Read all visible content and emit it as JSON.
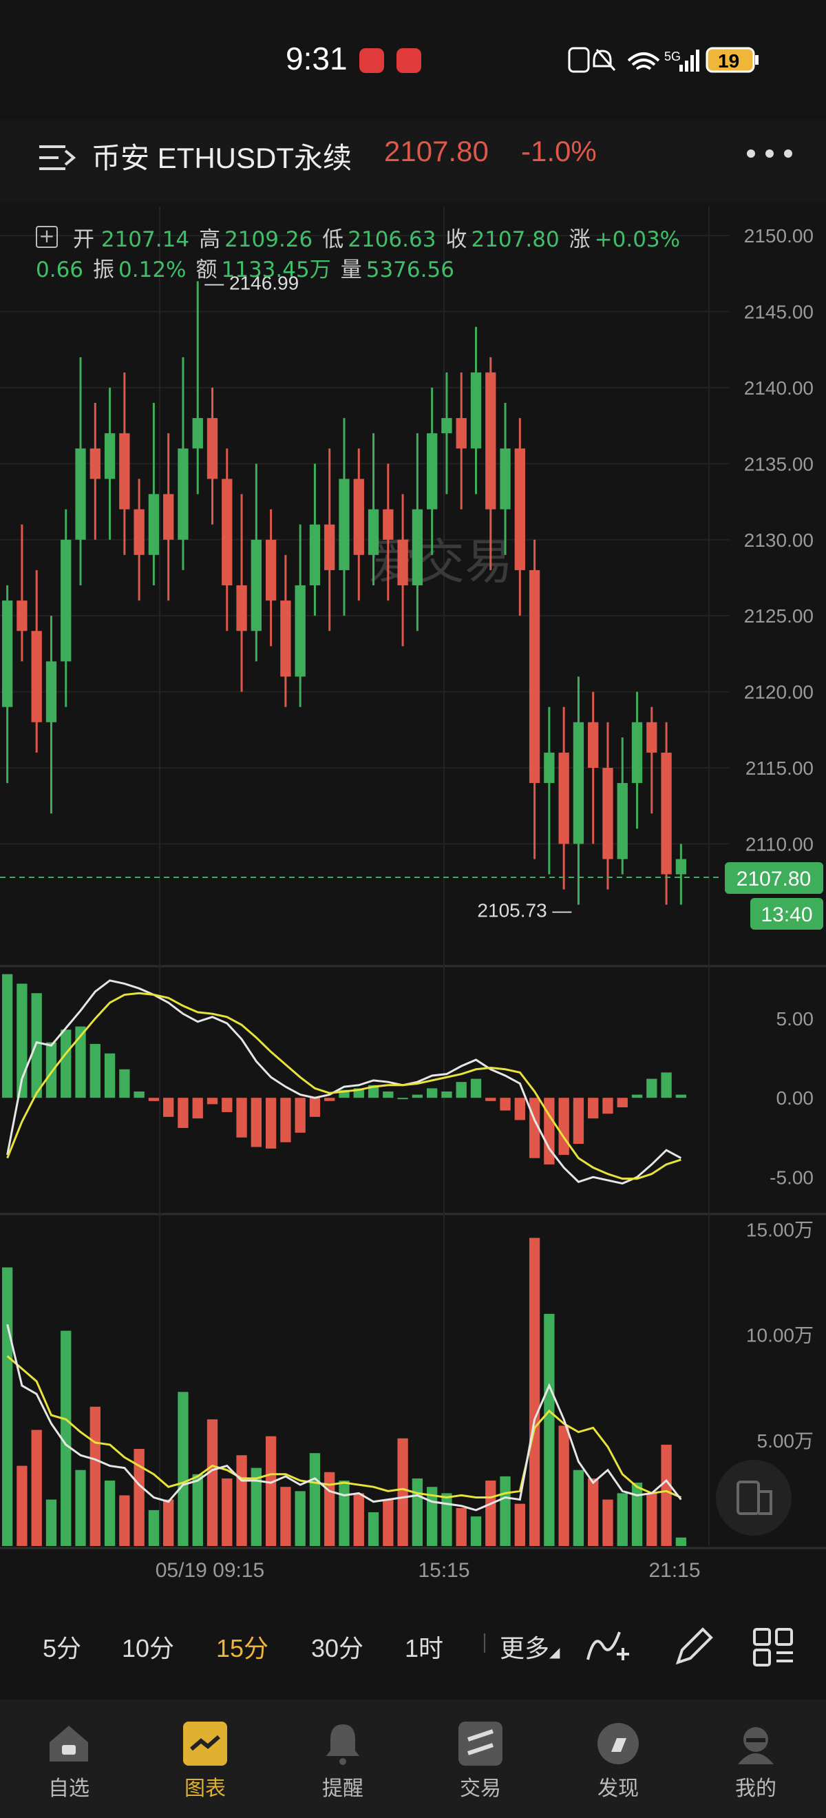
{
  "status_bar": {
    "time": "9:31",
    "battery": "19",
    "network": "5G"
  },
  "header": {
    "title": "币安 ETHUSDT永续",
    "price": "2107.80",
    "change": "-1.0%"
  },
  "ohlc": {
    "open_label": "开",
    "open": "2107.14",
    "high_label": "高",
    "high": "2109.26",
    "low_label": "低",
    "low": "2106.63",
    "close_label": "收",
    "close": "2107.80",
    "chg_label": "涨",
    "chg": "+0.03%",
    "chg_abs": "0.66",
    "amp_label": "振",
    "amp": "0.12%",
    "amount_label": "额",
    "amount": "1133.45万",
    "vol_label": "量",
    "vol": "5376.56"
  },
  "watermark": "爱交易",
  "chart_data": [
    {
      "type": "candlestick",
      "title": "",
      "price_axis_ticks": [
        "2150.00",
        "2145.00",
        "2140.00",
        "2135.00",
        "2130.00",
        "2125.00",
        "2120.00",
        "2115.00",
        "2110.00"
      ],
      "ylim": [
        2103,
        2151
      ],
      "high_marker": "2146.99",
      "low_marker": "2105.73",
      "last_price": "2107.80",
      "countdown": "13:40",
      "time_labels": [
        "05/19 09:15",
        "15:15",
        "21:15"
      ],
      "candles": [
        [
          2119,
          2126,
          2114,
          2127
        ],
        [
          2126,
          2124,
          2122,
          2131
        ],
        [
          2124,
          2118,
          2116,
          2128
        ],
        [
          2118,
          2122,
          2112,
          2125
        ],
        [
          2122,
          2130,
          2119,
          2132
        ],
        [
          2130,
          2136,
          2127,
          2142
        ],
        [
          2136,
          2134,
          2130,
          2139
        ],
        [
          2134,
          2137,
          2130,
          2140
        ],
        [
          2137,
          2132,
          2129,
          2141
        ],
        [
          2132,
          2129,
          2126,
          2134
        ],
        [
          2129,
          2133,
          2127,
          2139
        ],
        [
          2133,
          2130,
          2126,
          2137
        ],
        [
          2130,
          2136,
          2128,
          2142
        ],
        [
          2136,
          2138,
          2133,
          2147
        ],
        [
          2138,
          2134,
          2131,
          2140
        ],
        [
          2134,
          2127,
          2124,
          2136
        ],
        [
          2127,
          2124,
          2120,
          2133
        ],
        [
          2124,
          2130,
          2122,
          2135
        ],
        [
          2130,
          2126,
          2123,
          2132
        ],
        [
          2126,
          2121,
          2119,
          2129
        ],
        [
          2121,
          2127,
          2119,
          2131
        ],
        [
          2127,
          2131,
          2125,
          2135
        ],
        [
          2131,
          2128,
          2124,
          2136
        ],
        [
          2128,
          2134,
          2125,
          2138
        ],
        [
          2134,
          2129,
          2126,
          2136
        ],
        [
          2129,
          2132,
          2127,
          2137
        ],
        [
          2132,
          2130,
          2126,
          2135
        ],
        [
          2130,
          2127,
          2123,
          2133
        ],
        [
          2127,
          2132,
          2124,
          2137
        ],
        [
          2132,
          2137,
          2129,
          2140
        ],
        [
          2137,
          2138,
          2133,
          2141
        ],
        [
          2138,
          2136,
          2132,
          2141
        ],
        [
          2136,
          2141,
          2133,
          2144
        ],
        [
          2141,
          2132,
          2128,
          2142
        ],
        [
          2132,
          2136,
          2129,
          2139
        ],
        [
          2136,
          2128,
          2125,
          2138
        ],
        [
          2128,
          2114,
          2109,
          2130
        ],
        [
          2114,
          2116,
          2108,
          2119
        ],
        [
          2116,
          2110,
          2107,
          2119
        ],
        [
          2110,
          2118,
          2106,
          2121
        ],
        [
          2118,
          2115,
          2110,
          2120
        ],
        [
          2115,
          2109,
          2107,
          2118
        ],
        [
          2109,
          2114,
          2108,
          2117
        ],
        [
          2114,
          2118,
          2111,
          2120
        ],
        [
          2118,
          2116,
          2112,
          2119
        ],
        [
          2116,
          2108,
          2106,
          2118
        ],
        [
          2108,
          2109,
          2106,
          2110
        ]
      ]
    },
    {
      "type": "line",
      "name": "MACD",
      "y_ticks": [
        "5.00",
        "0.00",
        "-5.00"
      ],
      "ylim": [
        -7.2,
        8
      ],
      "series": [
        {
          "name": "DIF",
          "color": "#e6e6e6",
          "values": [
            -3.6,
            1.2,
            3.5,
            3.3,
            4.4,
            5.5,
            6.7,
            7.4,
            7.2,
            6.9,
            6.5,
            6.0,
            5.3,
            4.8,
            5.1,
            4.7,
            3.7,
            2.3,
            1.3,
            0.7,
            0.2,
            0.0,
            0.2,
            0.7,
            0.8,
            1.1,
            1.0,
            0.8,
            1.0,
            1.4,
            1.5,
            2.0,
            2.4,
            1.8,
            1.4,
            0.9,
            -1.4,
            -3.2,
            -4.4,
            -5.3,
            -5.0,
            -5.2,
            -5.4,
            -5.0,
            -4.2,
            -3.3,
            -3.8
          ]
        },
        {
          "name": "DEA",
          "color": "#e8e33a",
          "values": [
            -3.8,
            -1.5,
            0.3,
            1.6,
            2.8,
            3.9,
            5.0,
            6.0,
            6.5,
            6.6,
            6.5,
            6.3,
            5.8,
            5.4,
            5.3,
            5.1,
            4.6,
            3.8,
            2.9,
            2.1,
            1.3,
            0.6,
            0.3,
            0.4,
            0.5,
            0.7,
            0.8,
            0.8,
            0.9,
            1.1,
            1.3,
            1.5,
            1.8,
            1.9,
            1.8,
            1.6,
            0.4,
            -1.1,
            -2.5,
            -3.8,
            -4.4,
            -4.8,
            -5.1,
            -5.1,
            -4.8,
            -4.2,
            -3.9
          ]
        },
        {
          "name": "MACD",
          "values": [
            7.8,
            7.2,
            6.6,
            3.5,
            4.3,
            4.5,
            3.4,
            2.8,
            1.8,
            0.4,
            -0.2,
            -1.2,
            -1.9,
            -1.3,
            -0.4,
            -0.9,
            -2.5,
            -3.1,
            -3.2,
            -2.8,
            -2.2,
            -1.2,
            -0.2,
            0.5,
            0.6,
            0.8,
            0.4,
            0.0,
            0.2,
            0.6,
            0.4,
            1.0,
            1.2,
            -0.2,
            -0.8,
            -1.4,
            -3.8,
            -4.2,
            -3.6,
            -2.9,
            -1.3,
            -1.0,
            -0.6,
            0.2,
            1.2,
            1.6,
            0.2
          ]
        }
      ]
    },
    {
      "type": "bar",
      "name": "Volume",
      "y_ticks": [
        "15.00万",
        "10.00万",
        "5.00万"
      ],
      "ylim": [
        0,
        15.5
      ],
      "values": [
        13.2,
        3.8,
        5.5,
        2.2,
        10.2,
        3.6,
        6.6,
        3.1,
        2.4,
        4.6,
        1.7,
        2.2,
        7.3,
        3.4,
        6.0,
        3.2,
        4.3,
        3.7,
        5.2,
        2.8,
        2.6,
        4.4,
        3.5,
        3.1,
        2.5,
        1.6,
        2.2,
        5.1,
        3.2,
        2.8,
        2.5,
        1.8,
        1.4,
        3.1,
        3.3,
        2.0,
        14.6,
        11.0,
        5.7,
        3.6,
        3.2,
        2.2,
        2.5,
        3.0,
        2.5,
        4.8,
        0.4
      ],
      "ma1": {
        "color": "#e8e33a",
        "values": [
          9.0,
          8.4,
          7.8,
          6.2,
          6.0,
          5.4,
          4.9,
          4.8,
          4.2,
          3.8,
          3.4,
          2.8,
          3.0,
          3.3,
          3.8,
          3.6,
          3.2,
          3.2,
          3.4,
          3.4,
          3.1,
          3.0,
          2.9,
          3.0,
          2.9,
          2.8,
          2.6,
          2.7,
          2.5,
          2.4,
          2.3,
          2.4,
          2.3,
          2.3,
          2.5,
          2.6,
          5.6,
          6.4,
          5.8,
          5.4,
          5.6,
          4.7,
          3.4,
          2.8,
          2.5,
          2.6,
          2.3
        ]
      },
      "ma2": {
        "color": "#e6e6e6",
        "values": [
          10.5,
          7.6,
          7.2,
          5.8,
          4.8,
          4.3,
          4.1,
          3.8,
          3.7,
          2.9,
          2.3,
          2.1,
          2.9,
          3.1,
          3.6,
          3.8,
          3.1,
          3.1,
          3.0,
          3.3,
          2.9,
          3.2,
          2.6,
          2.4,
          2.5,
          2.1,
          2.2,
          2.3,
          2.4,
          2.1,
          2.0,
          1.9,
          1.7,
          2.0,
          2.3,
          2.2,
          6.0,
          7.6,
          6.0,
          4.0,
          3.0,
          3.6,
          2.6,
          2.4,
          2.5,
          3.1,
          2.2
        ]
      }
    }
  ],
  "timeframes": {
    "items": [
      "5分",
      "10分",
      "15分",
      "30分",
      "1时"
    ],
    "selected": "15分",
    "more": "更多"
  },
  "bottom_nav": {
    "items": [
      "自选",
      "图表",
      "提醒",
      "交易",
      "发现",
      "我的"
    ],
    "selected": "图表"
  },
  "colors": {
    "up": "#3fae5b",
    "down": "#e0584a",
    "accent": "#f0b63a",
    "background": "#141414"
  }
}
